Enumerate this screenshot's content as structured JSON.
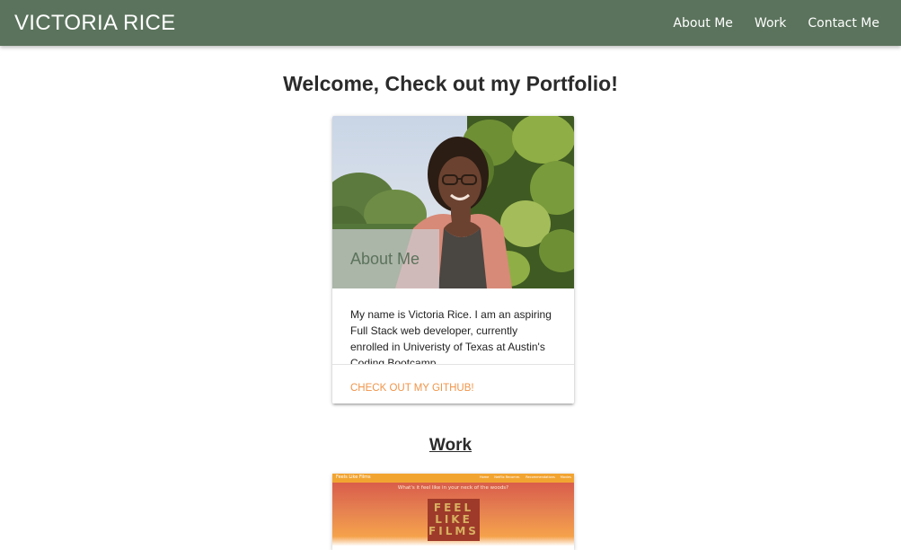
{
  "navbar": {
    "brand": "VICTORIA RICE",
    "links": [
      "About Me",
      "Work",
      "Contact Me"
    ]
  },
  "welcome": "Welcome, Check out my Portfolio!",
  "about_card": {
    "title": "About Me",
    "text": "My name is Victoria Rice. I am an aspiring Full Stack web developer, currently enrolled in Univeristy of Texas at Austin's Coding Bootcamp.",
    "action": "CHECK OUT MY GITHUB!",
    "image": "profile-photo"
  },
  "work": {
    "heading": "Work",
    "project": {
      "site_name": "Feels Like Films",
      "nav": [
        "Home",
        "Netflix Recomm.",
        "Recommendations",
        "Movies"
      ],
      "caption": "What's it feel like in your neck of the woods?",
      "logo": [
        "FEEL",
        "LIKE",
        "FILMS"
      ]
    }
  },
  "colors": {
    "navbar": "#5b735c",
    "accent_link": "#f0954a",
    "card_title": "#5b735c"
  }
}
